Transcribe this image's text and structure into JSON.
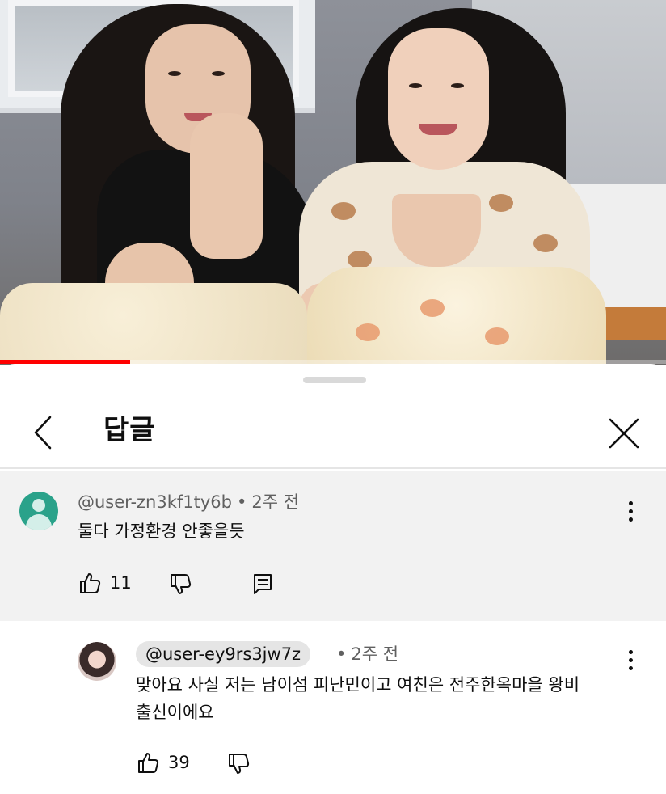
{
  "video": {
    "progress_fraction": 0.195,
    "accent": "#ff0000"
  },
  "sheet": {
    "title": "답글",
    "back_icon": "chevron-left-icon",
    "close_icon": "close-icon"
  },
  "parent_comment": {
    "author": "@user-zn3kf1ty6b",
    "separator": "•",
    "time": "2주 전",
    "text": "둘다 가정환경 안좋을듯",
    "likes": "11",
    "avatar_color": "#2aa28a"
  },
  "reply": {
    "author": "@user-ey9rs3jw7z",
    "separator": "•",
    "time": "2주 전",
    "text_line1": "맞아요 사실 저는 남이섬 피난민이고 여친은 전주한옥마을 왕비",
    "text_line2": "출신이에요",
    "likes": "39"
  }
}
